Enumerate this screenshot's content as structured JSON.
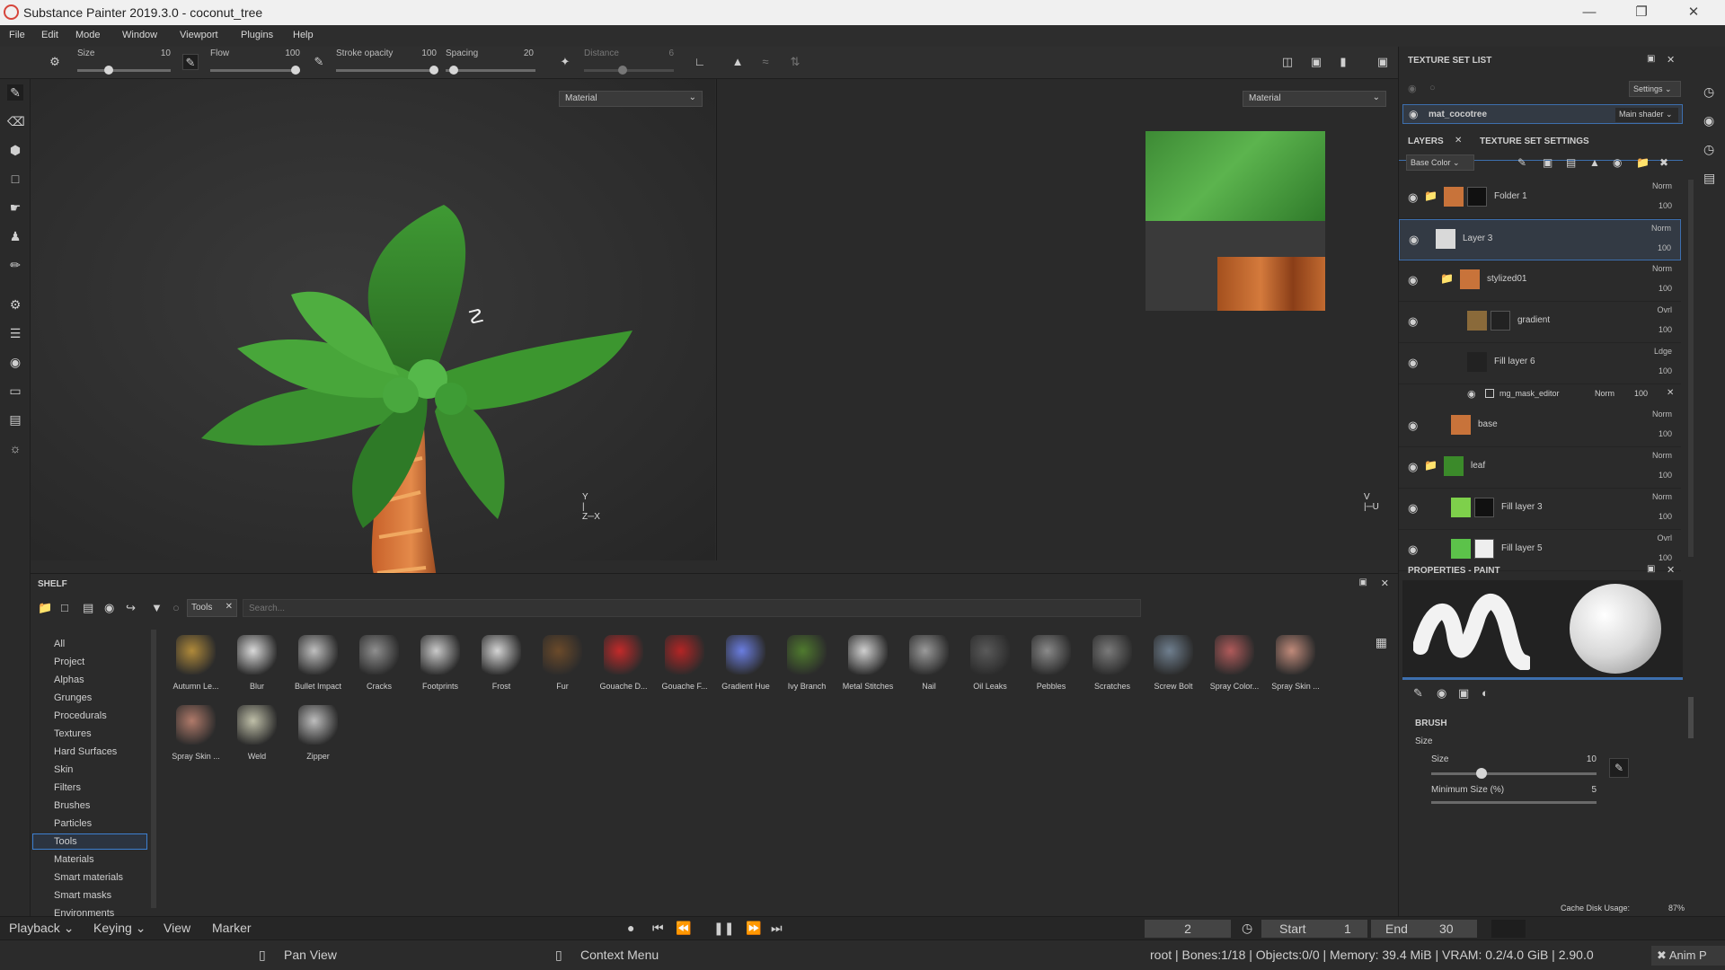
{
  "window": {
    "title": "Substance Painter 2019.3.0 - coconut_tree"
  },
  "menu": [
    "File",
    "Edit",
    "Mode",
    "Window",
    "Viewport",
    "Plugins",
    "Help"
  ],
  "toolbar": {
    "size_label": "Size",
    "size_value": "10",
    "flow_label": "Flow",
    "flow_value": "100",
    "stroke_opacity_label": "Stroke opacity",
    "stroke_opacity_value": "100",
    "spacing_label": "Spacing",
    "spacing_value": "20",
    "distance_label": "Distance",
    "distance_value": "6"
  },
  "viewport": {
    "left_mode": "Material",
    "right_mode": "Material"
  },
  "texture_set_list": {
    "title": "TEXTURE SET LIST",
    "settings_label": "Settings",
    "set_name": "mat_cocotree",
    "shader": "Main shader"
  },
  "layers_panel": {
    "tab_layers": "LAYERS",
    "tab_texture_set_settings": "TEXTURE SET SETTINGS",
    "channel": "Base Color",
    "rows": [
      {
        "name": "Folder 1",
        "blend": "Norm",
        "opacity": "100",
        "thumb_color": "#c8733a",
        "mask_color": "#111111",
        "type": "folder"
      },
      {
        "name": "Layer 3",
        "blend": "Norm",
        "opacity": "100",
        "thumb_color": "#d9d9d9",
        "mask_color": "",
        "type": "layer",
        "selected": true
      },
      {
        "name": "stylized01",
        "blend": "Norm",
        "opacity": "100",
        "thumb_color": "#c8733a",
        "mask_color": "",
        "type": "folder"
      },
      {
        "name": "gradient",
        "blend": "Ovrl",
        "opacity": "100",
        "thumb_color": "#8a6a3a",
        "mask_color": "#222222",
        "type": "layer"
      },
      {
        "name": "Fill layer 6",
        "blend": "Ldge",
        "opacity": "100",
        "thumb_color": "#222222",
        "mask_color": "",
        "type": "layer"
      },
      {
        "name": "base",
        "blend": "Norm",
        "opacity": "100",
        "thumb_color": "#c8733a",
        "mask_color": "",
        "type": "layer"
      },
      {
        "name": "leaf",
        "blend": "Norm",
        "opacity": "100",
        "thumb_color": "#3b8a2a",
        "mask_color": "",
        "type": "folder"
      },
      {
        "name": "Fill layer 3",
        "blend": "Norm",
        "opacity": "100",
        "thumb_color": "#7ed04b",
        "mask_color": "#111111",
        "type": "layer"
      },
      {
        "name": "Fill layer 5",
        "blend": "Ovrl",
        "opacity": "100",
        "thumb_color": "#5cc24a",
        "mask_color": "#eeeeee",
        "type": "layer"
      }
    ],
    "mask_effect": {
      "name": "mg_mask_editor",
      "blend": "Norm",
      "opacity": "100"
    }
  },
  "properties": {
    "title": "PROPERTIES - PAINT",
    "section": "BRUSH",
    "size_group": "Size",
    "size_label": "Size",
    "size_value": "10",
    "min_size_label": "Minimum Size (%)",
    "min_size_value": "5"
  },
  "shelf": {
    "title": "SHELF",
    "filter_tag": "Tools",
    "search_placeholder": "Search...",
    "categories": [
      "All",
      "Project",
      "Alphas",
      "Grunges",
      "Procedurals",
      "Textures",
      "Hard Surfaces",
      "Skin",
      "Filters",
      "Brushes",
      "Particles",
      "Tools",
      "Materials",
      "Smart materials",
      "Smart masks",
      "Environments"
    ],
    "selected_category": "Tools",
    "items": [
      {
        "label": "Autumn Le...",
        "color": "#b08a3a"
      },
      {
        "label": "Blur",
        "color": "#d9d9d9"
      },
      {
        "label": "Bullet Impact",
        "color": "#bfbfbf"
      },
      {
        "label": "Cracks",
        "color": "#8f8f8f"
      },
      {
        "label": "Footprints",
        "color": "#c9c9c9"
      },
      {
        "label": "Frost",
        "color": "#d4d4d4"
      },
      {
        "label": "Fur",
        "color": "#6b4a2a"
      },
      {
        "label": "Gouache D...",
        "color": "#c22a2a"
      },
      {
        "label": "Gouache F...",
        "color": "#b32525"
      },
      {
        "label": "Gradient Hue",
        "color": "#6a7de0"
      },
      {
        "label": "Ivy Branch",
        "color": "#4f7a2e"
      },
      {
        "label": "Metal Stitches",
        "color": "#cfcfcf"
      },
      {
        "label": "Nail",
        "color": "#9a9a9a"
      },
      {
        "label": "Oil Leaks",
        "color": "#5a5a5a"
      },
      {
        "label": "Pebbles",
        "color": "#8a8a8a"
      },
      {
        "label": "Scratches",
        "color": "#7a7a7a"
      },
      {
        "label": "Screw Bolt",
        "color": "#6f7f8f"
      },
      {
        "label": "Spray Color...",
        "color": "#b05a5a"
      },
      {
        "label": "Spray Skin ...",
        "color": "#c08a7a"
      },
      {
        "label": "Spray Skin ...",
        "color": "#b07a6a"
      },
      {
        "label": "Weld",
        "color": "#bfbfa8"
      },
      {
        "label": "Zipper",
        "color": "#bdbdbd"
      }
    ]
  },
  "timeline": {
    "playback": "Playback",
    "keying": "Keying",
    "view": "View",
    "marker": "Marker",
    "frame": "2",
    "start_label": "Start",
    "start_value": "1",
    "end_label": "End",
    "end_value": "30",
    "cache": "Cache Disk Usage:",
    "cache_value": "87%"
  },
  "statusbar": {
    "pan_view": "Pan View",
    "context_menu": "Context Menu",
    "stats": "root | Bones:1/18 | Objects:0/0 | Memory: 39.4 MiB | VRAM: 0.2/4.0 GiB | 2.90.0",
    "anim": "Anim P"
  }
}
